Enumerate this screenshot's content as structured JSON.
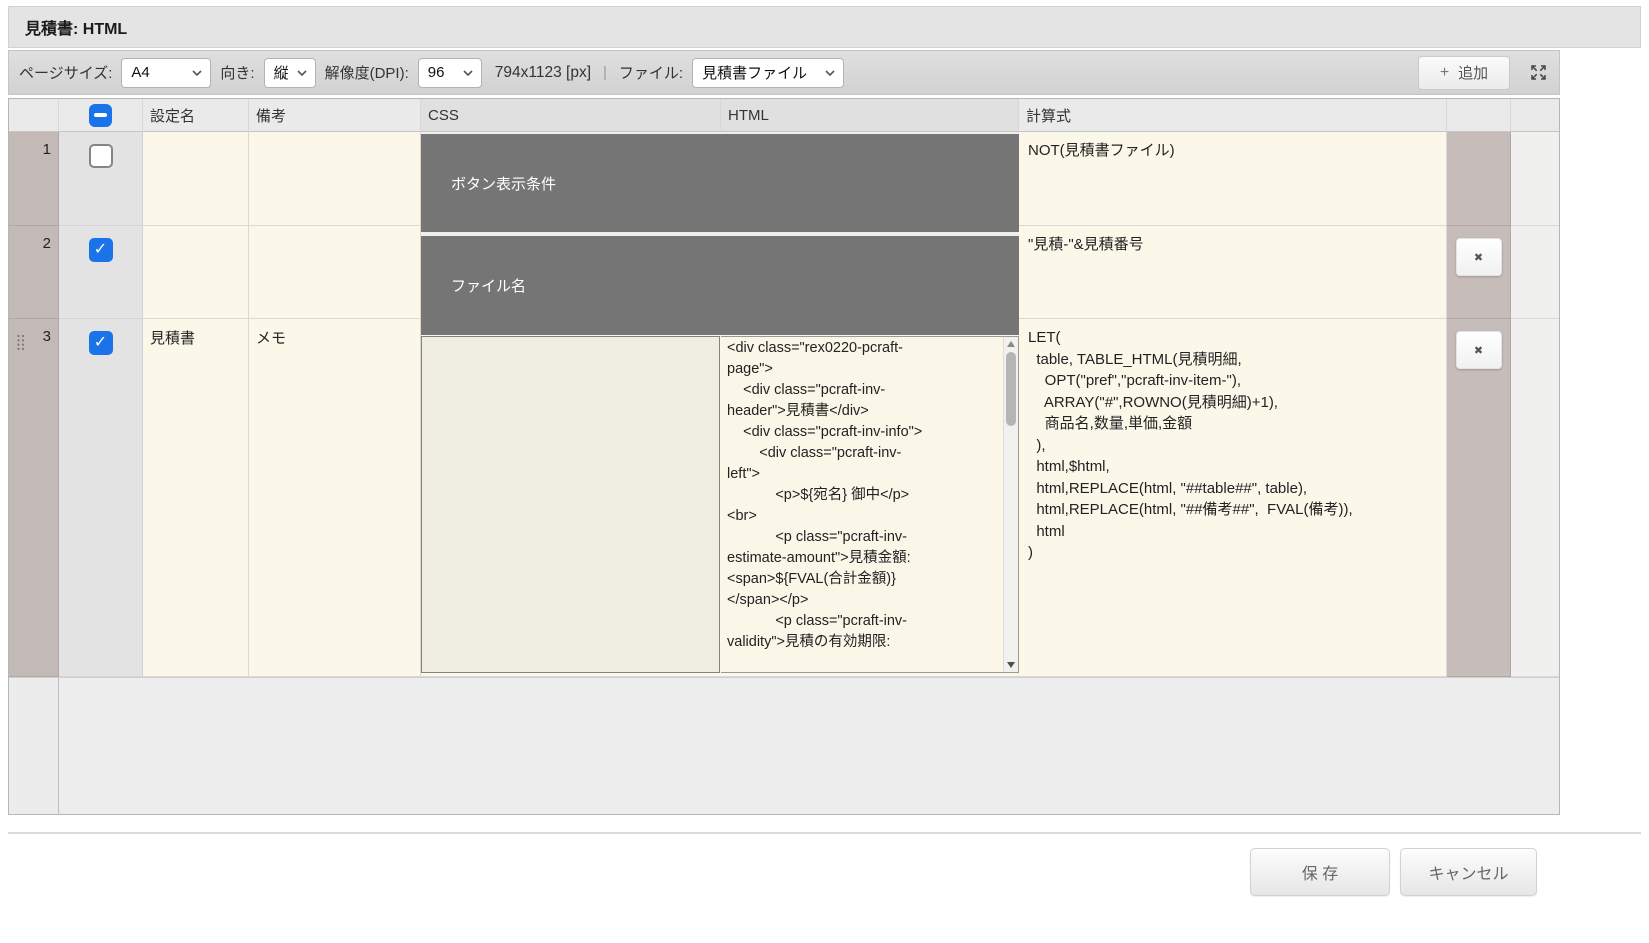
{
  "title_bar": {
    "title": "見積書: HTML"
  },
  "toolbar": {
    "page_size_label": "ページサイズ:",
    "page_size_value": "A4",
    "orientation_label": "向き:",
    "orientation_value": "縦",
    "dpi_label": "解像度(DPI):",
    "dpi_value": "96",
    "dimensions_text": "794x1123 [px]",
    "separator": "|",
    "file_label": "ファイル:",
    "file_value": "見積書ファイル",
    "add_button_label": "追加"
  },
  "icons": {
    "plus": "+",
    "check": "✓",
    "delete": "✖"
  },
  "table": {
    "select_all_state": "indeterminate",
    "headers": {
      "name": "設定名",
      "memo": "備考",
      "css": "CSS",
      "html": "HTML",
      "formula": "計算式"
    },
    "rows": [
      {
        "num": "1",
        "checked": false,
        "name": "",
        "memo": "",
        "overlay_label": "ボタン表示条件",
        "formula": "NOT(見積書ファイル)"
      },
      {
        "num": "2",
        "checked": true,
        "name": "",
        "memo": "",
        "overlay_label": "ファイル名",
        "formula": "\"見積-\"&見積番号"
      },
      {
        "num": "3",
        "checked": true,
        "name": "見積書",
        "memo": "メモ",
        "html_code": "<div class=\"rex0220-pcraft-\npage\">\n    <div class=\"pcraft-inv-\nheader\">見積書</div>\n    <div class=\"pcraft-inv-info\">\n        <div class=\"pcraft-inv-\nleft\">\n            <p>${宛名} 御中</p>\n<br>\n            <p class=\"pcraft-inv-\nestimate-amount\">見積金額:\n<span>${FVAL(合計金額)}\n</span></p>\n            <p class=\"pcraft-inv-\nvalidity\">見積の有効期限:",
        "formula": "LET(\n  table, TABLE_HTML(見積明細,\n    OPT(\"pref\",\"pcraft-inv-item-\"),\n    ARRAY(\"#\",ROWNO(見積明細)+1),\n    商品名,数量,単価,金額\n  ),\n  html,$html,\n  html,REPLACE(html, \"##table##\", table),\n  html,REPLACE(html, \"##備考##\",  FVAL(備考)),\n  html\n)"
      }
    ]
  },
  "footer": {
    "save_button": "保 存",
    "cancel_button": "キャンセル"
  },
  "colors": {
    "accent_blue": "#1a73e8",
    "dark_cell": "#757575",
    "cream_cell": "#fbf8ea",
    "rownum_column": "#c3b9b6"
  }
}
